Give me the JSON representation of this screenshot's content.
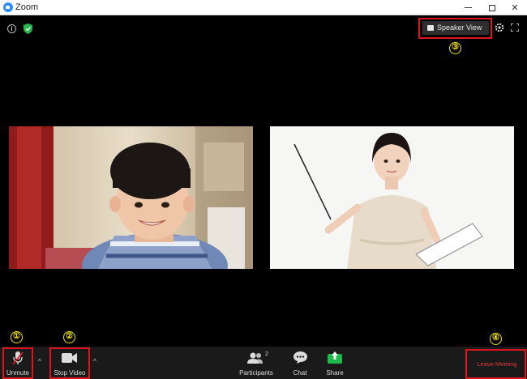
{
  "window": {
    "title": "Zoom",
    "controls": {
      "minimize": "",
      "maximize": "",
      "close": "✕"
    }
  },
  "top_bar": {
    "speaker_view_label": "Speaker View"
  },
  "callouts": [
    "①",
    "②",
    "③",
    "④"
  ],
  "toolbar": {
    "unmute_label": "Unmute",
    "stop_video_label": "Stop Video",
    "participants_label": "Participants",
    "participants_count": "2",
    "chat_label": "Chat",
    "share_label": "Share",
    "leave_label": "Leave Meeting",
    "caret": "^"
  },
  "colors": {
    "callout_red": "#e0141e",
    "callout_yellow": "#f2e30c",
    "share_green": "#1fb84a",
    "leave_red": "#e03a3a",
    "muted_red": "#e0141e"
  },
  "icons": [
    "zoom-app-icon",
    "info-icon",
    "shield-icon",
    "speaker-view-icon",
    "gear-icon",
    "fullscreen-icon",
    "microphone-muted-icon",
    "video-camera-icon",
    "participants-icon",
    "chat-icon",
    "share-icon",
    "caret-up-icon"
  ]
}
